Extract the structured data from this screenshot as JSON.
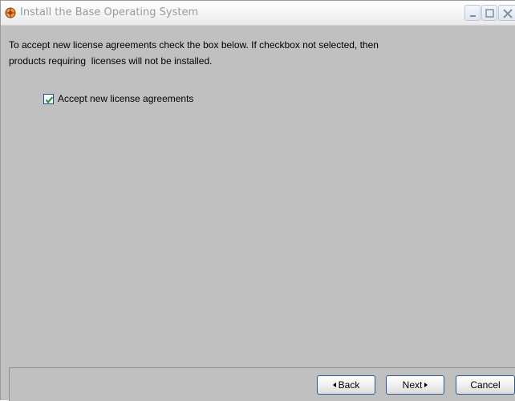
{
  "window": {
    "title": "Install the Base Operating System",
    "controls": [
      "minimize-icon",
      "maximize-icon",
      "close-icon"
    ]
  },
  "content": {
    "instruction_line1": "To accept new license agreements check the box below. If checkbox not selected, then",
    "instruction_line2": "products requiring  licenses will not be installed.",
    "checkbox": {
      "label": "Accept new license agreements",
      "checked": true
    }
  },
  "buttons": {
    "back": "Back",
    "next": "Next",
    "cancel": "Cancel"
  },
  "colors": {
    "panel_background": "#c0c0c0",
    "title_text": "#9a9a9a",
    "checkmark": "#2e8b3a",
    "button_border": "#2b5a8a"
  }
}
